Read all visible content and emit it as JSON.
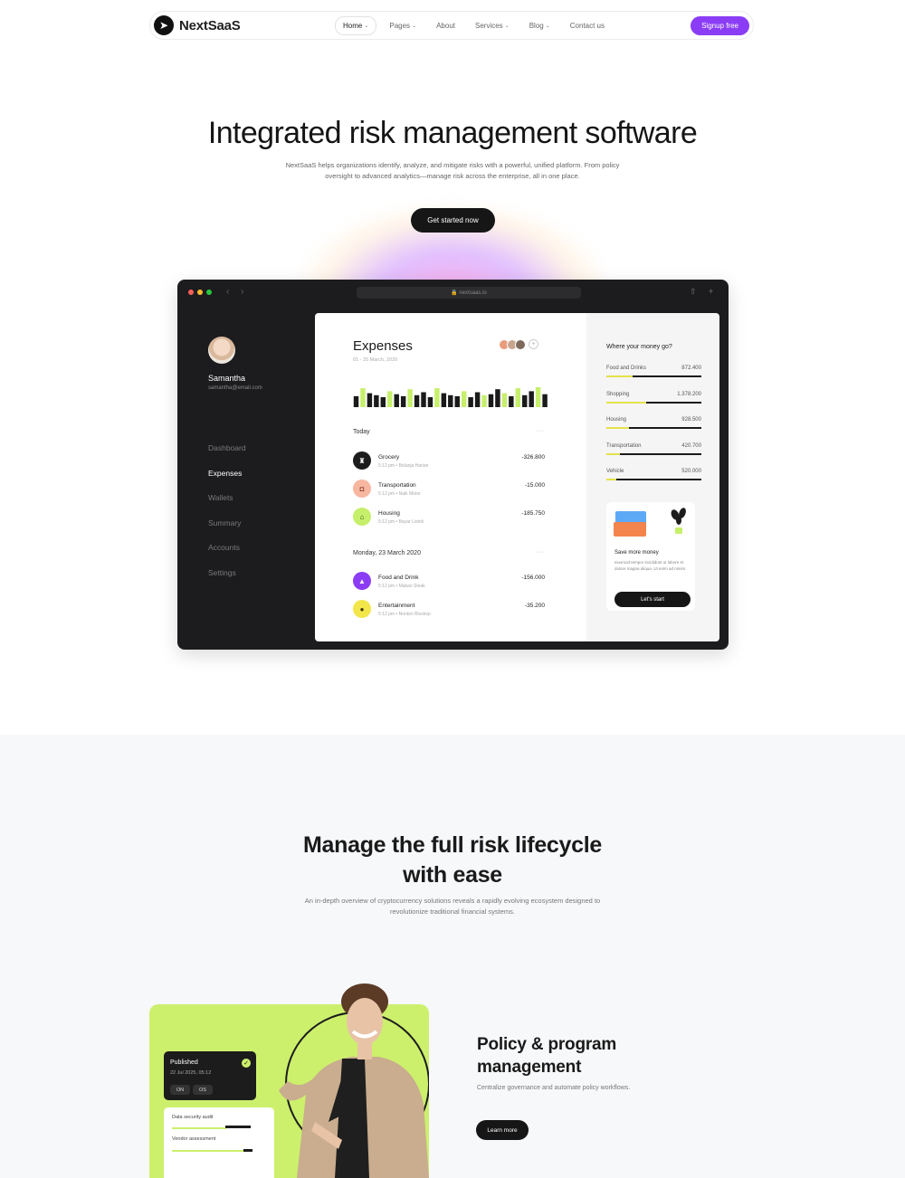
{
  "nav": {
    "logo": "NextSaaS",
    "links": [
      {
        "label": "Home",
        "dropdown": true,
        "active": true
      },
      {
        "label": "Pages",
        "dropdown": true
      },
      {
        "label": "About",
        "dropdown": false
      },
      {
        "label": "Services",
        "dropdown": true
      },
      {
        "label": "Blog",
        "dropdown": true
      },
      {
        "label": "Contact us",
        "dropdown": false
      }
    ],
    "signup": "Signup free",
    "accent": "#8b3df5"
  },
  "hero": {
    "title": "Integrated risk management software",
    "subtitle": "NextSaaS helps organizations identify, analyze, and mitigate risks with a powerful, unified platform. From policy oversight to advanced analytics—manage risk across the enterprise, all in one place.",
    "cta": "Get started now"
  },
  "browser": {
    "url": "nextsaas.io",
    "user": {
      "name": "Samantha",
      "email": "samantha@email.com"
    },
    "menu": [
      {
        "label": "Dashboard",
        "active": false
      },
      {
        "label": "Expenses",
        "active": true
      },
      {
        "label": "Wallets",
        "active": false
      },
      {
        "label": "Summary",
        "active": false
      },
      {
        "label": "Accounts",
        "active": false
      },
      {
        "label": "Settings",
        "active": false
      }
    ],
    "expenses": {
      "title": "Expenses",
      "date": "01 - 25 March, 2020",
      "bar_levels": [
        0.55,
        0.95,
        0.7,
        0.6,
        0.5,
        0.8,
        0.65,
        0.55,
        0.9,
        0.6,
        0.75,
        0.5,
        0.95,
        0.7,
        0.6,
        0.55,
        0.8,
        0.5,
        0.75,
        0.6,
        0.65,
        0.9,
        0.7,
        0.55,
        0.95,
        0.6,
        0.8,
        1.0,
        0.65
      ],
      "bar_highlight": [
        1,
        5,
        8,
        12,
        16,
        19,
        22,
        24,
        27
      ],
      "today_label": "Today",
      "today": [
        {
          "name": "Grocery",
          "meta": "5:12 pm • Belanja Harian",
          "amount": "-326.800",
          "icon_bg": "#1c1c1c",
          "icon_color": "#ffffff",
          "icon": "cart-icon",
          "glyph": "♜"
        },
        {
          "name": "Transportation",
          "meta": "5:12 pm • Naik Motor",
          "amount": "-15.000",
          "icon_bg": "#f7b6a0",
          "icon_color": "#7a2f1a",
          "icon": "car-icon",
          "glyph": "◘"
        },
        {
          "name": "Housing",
          "meta": "5:12 pm • Bayar Listrik",
          "amount": "-185.750",
          "icon_bg": "#c6ef6b",
          "icon_color": "#2e4a0a",
          "icon": "house-icon",
          "glyph": "⌂"
        }
      ],
      "earlier_label": "Monday, 23 March 2020",
      "earlier": [
        {
          "name": "Food and Drink",
          "meta": "5:12 pm • Makan Steak",
          "amount": "-156.000",
          "icon_bg": "#8b3df5",
          "icon_color": "#ffffff",
          "icon": "food-icon",
          "glyph": "▲"
        },
        {
          "name": "Entertainment",
          "meta": "5:12 pm • Nonton Bioskop",
          "amount": "-35.200",
          "icon_bg": "#f3e64a",
          "icon_color": "#3d3600",
          "icon": "ticket-icon",
          "glyph": "●"
        }
      ]
    },
    "breakdown": {
      "title": "Where your money go?",
      "items": [
        {
          "name": "Food and Drinks",
          "value": "872.400",
          "fill": 0.28
        },
        {
          "name": "Shopping",
          "value": "1.378.200",
          "fill": 0.42
        },
        {
          "name": "Housing",
          "value": "928.500",
          "fill": 0.24
        },
        {
          "name": "Transportation",
          "value": "420.700",
          "fill": 0.14
        },
        {
          "name": "Vehicle",
          "value": "520.000",
          "fill": 0.1
        }
      ]
    },
    "promo": {
      "title": "Save more money",
      "text": "eiusmod tempor incididunt ut labore et dolore magna aliqua. Ut enim ad minim.",
      "button": "Let's start"
    }
  },
  "section2": {
    "title_line1": "Manage the full risk lifecycle",
    "title_line2": "with ease",
    "subtitle": "An in-depth overview of cryptocurrency solutions reveals a rapidly evolving ecosystem designed to revolutionize traditional financial systems.",
    "card": {
      "published": "Published",
      "date": "22 Jul 2025, 05:12",
      "tag1": "ON",
      "tag2": "OS",
      "row1": "Data security audit",
      "row2": "Vendor assessment"
    },
    "feature": {
      "title_line1": "Policy & program",
      "title_line2": "management",
      "subtitle": "Centralize governance and automate policy workflows.",
      "button": "Learn more"
    },
    "accent": "#ccf06c"
  }
}
